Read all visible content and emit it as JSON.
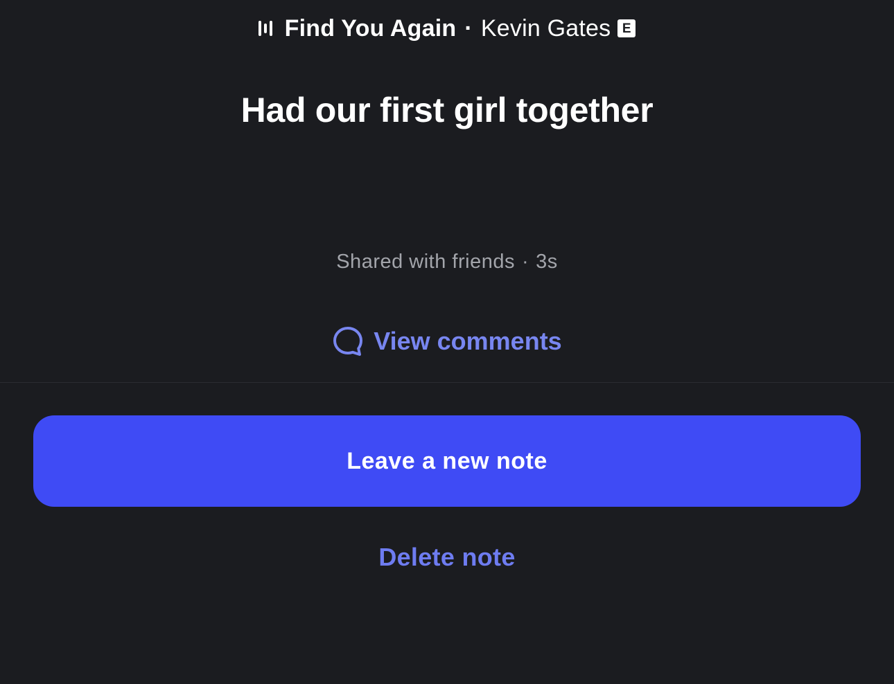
{
  "song": {
    "title": "Find You Again",
    "separator": "·",
    "artist": "Kevin Gates",
    "explicit_badge": "E",
    "icon": "music-bars-icon"
  },
  "note": {
    "text": "Had our first girl together"
  },
  "meta": {
    "audience": "Shared with friends",
    "separator": "·",
    "age": "3s"
  },
  "comments": {
    "label": "View comments",
    "icon": "comment-bubble-icon"
  },
  "actions": {
    "primary_label": "Leave a new note",
    "delete_label": "Delete note"
  },
  "colors": {
    "background": "#1b1c20",
    "accent": "#3f4bf5",
    "link": "#7886f0",
    "muted_text": "#a3a5ab"
  }
}
